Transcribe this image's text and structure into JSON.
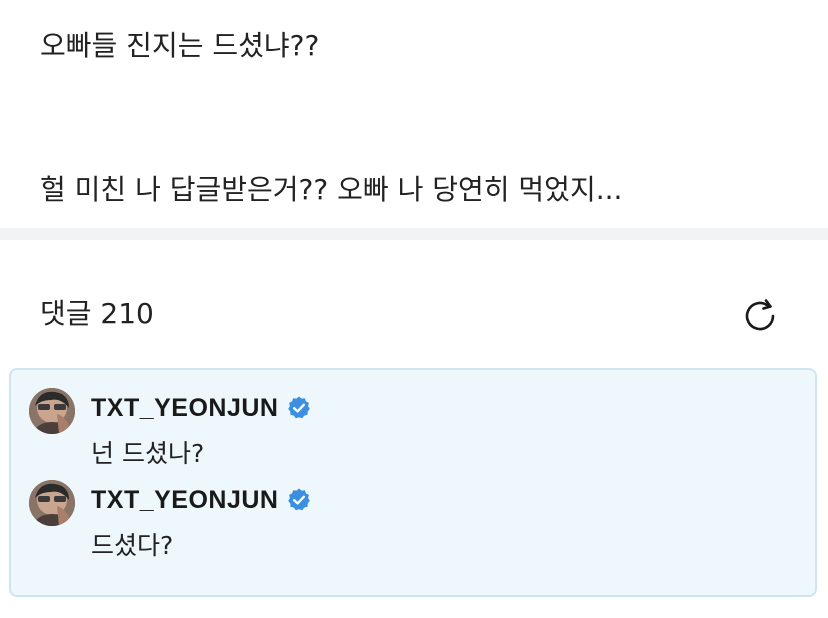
{
  "post": {
    "lines": [
      "오빠들 진지는 드셨냐??",
      "헐 미친 나 답글받은거?? 오빠 나 당연히 먹었지..."
    ]
  },
  "comments": {
    "title": "댓글 210",
    "refresh_icon": "refresh-icon"
  },
  "replies": [
    {
      "author": "TXT_YEONJUN",
      "verified": true,
      "text": "넌 드셨나?"
    },
    {
      "author": "TXT_YEONJUN",
      "verified": true,
      "text": "드셨다?"
    }
  ],
  "colors": {
    "reply_background": "#eef7fc",
    "reply_border": "#cfe6f2",
    "verified_badge": "#3c8fe0",
    "divider": "#f2f3f5"
  }
}
